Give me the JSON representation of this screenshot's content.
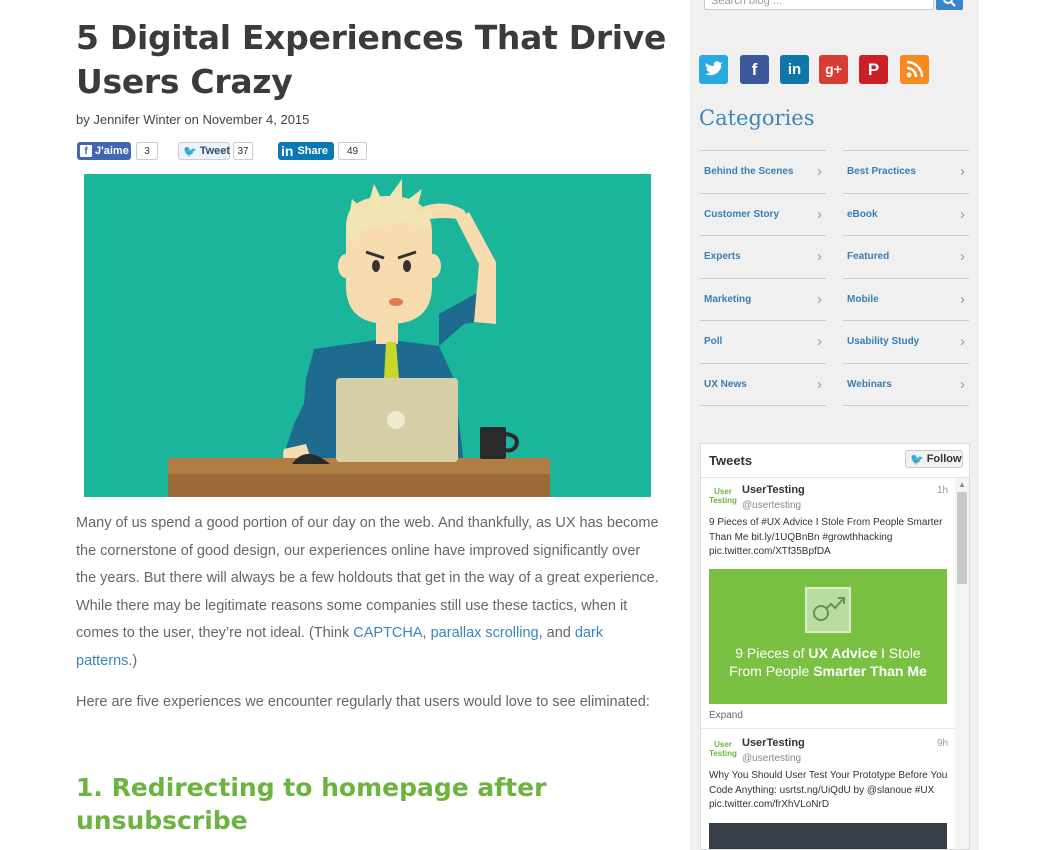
{
  "article": {
    "title": "5 Digital Experiences That Drive Users Crazy",
    "byline": "by Jennifer Winter on November 4, 2015",
    "share": {
      "facebook_label": "J'aime",
      "facebook_count": "3",
      "twitter_label": "Tweet",
      "twitter_count": "37",
      "linkedin_label": "Share",
      "linkedin_count": "49"
    },
    "p1": {
      "text1": "Many of us spend a good portion of our day on the web. And thankfully, as UX has become the cornerstone of good design, our experiences online have improved significantly over the years. But there will always be a few holdouts that get in the way of a great experience. While there may be legitimate reasons some companies still use these tactics, when it comes to the user, they’re not ideal. (Think ",
      "link1": "CAPTCHA",
      "sep1": ", ",
      "link2": "parallax scrolling",
      "sep2": ", and ",
      "link3": "dark patterns",
      "end": ".)"
    },
    "p2": "Here are five experiences we encounter regularly that users would love to see eliminated:",
    "h2": "1. Redirecting to homepage after unsubscribe"
  },
  "sidebar": {
    "search_placeholder": "Search blog ...",
    "social_icons": [
      "twitter-icon",
      "facebook-icon",
      "linkedin-icon",
      "googleplus-icon",
      "pinterest-icon",
      "rss-icon"
    ],
    "categories_title": "Categories",
    "categories": [
      "Behind the Scenes",
      "Best Practices",
      "Customer Story",
      "eBook",
      "Experts",
      "Featured",
      "Marketing",
      "Mobile",
      "Poll",
      "Usability Study",
      "UX News",
      "Webinars"
    ]
  },
  "tweets": {
    "title": "Tweets",
    "follow_label": "Follow",
    "avatar_text": "User Testing",
    "items": [
      {
        "name": "UserTesting",
        "handle": "@usertesting",
        "time": "1h",
        "text": "9 Pieces of #UX Advice I Stole From People Smarter Than Me bit.ly/1UQBnBn #growthhacking pic.twitter.com/XTf35BpfDA",
        "card_light1": "9 Pieces of ",
        "card_bold1": "UX Advice",
        "card_light2": " I Stole From People ",
        "card_bold2": "Smarter Than Me",
        "expand": "Expand"
      },
      {
        "name": "UserTesting",
        "handle": "@usertesting",
        "time": "9h",
        "text": "Why You Should User Test Your Prototype Before You Code Anything: usrtst.ng/UiQdU by @slanoue #UX pic.twitter.com/frXhVLoNrD"
      }
    ]
  },
  "colors": {
    "title": "#3b3b3b",
    "link": "#3a86b9",
    "heading_green": "#6cb33f",
    "category_title": "#3d86b8",
    "hero_bg": "#1ab59a"
  }
}
